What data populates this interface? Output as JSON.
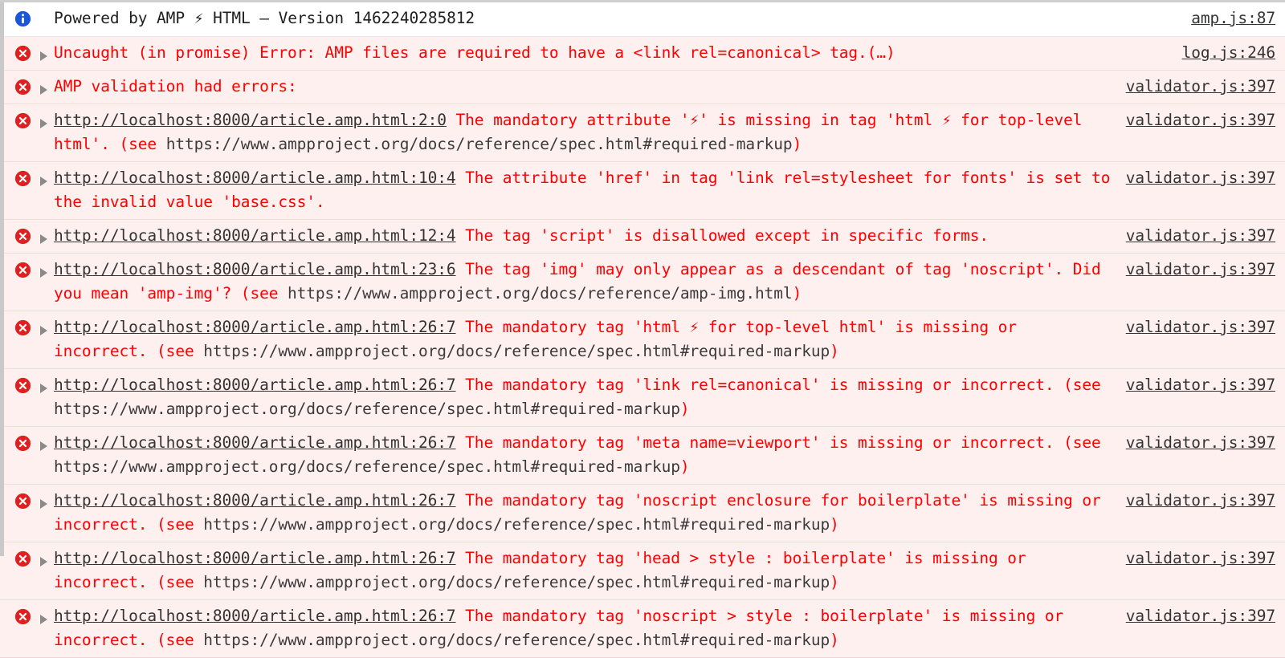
{
  "console": {
    "title": "Browser DevTools Console",
    "colors": {
      "error_text": "#ff0000",
      "error_row_bg": "#fff0f0",
      "error_row_border": "#ffd6d6",
      "info_row_bg": "#ffffff",
      "link_text": "#333333",
      "url_text": "#3b3b3b",
      "error_icon": "#e02020",
      "info_icon": "#1a56d6",
      "disclosure_triangle": "#8a8a8a",
      "gutter": "#c9c9c9"
    },
    "messages": [
      {
        "severity": "info",
        "icon": "info-circle-icon",
        "has_disclosure": false,
        "source": "amp.js:87",
        "parts": [
          {
            "style": "plain",
            "text": "Powered by AMP "
          },
          {
            "style": "bolt",
            "text": "⚡"
          },
          {
            "style": "plain",
            "text": " HTML — Version 1462240285812"
          }
        ]
      },
      {
        "severity": "error",
        "icon": "error-circle-icon",
        "has_disclosure": true,
        "source": "log.js:246",
        "parts": [
          {
            "style": "red",
            "text": "Uncaught (in promise) Error: AMP files are required to have a <link rel=canonical> tag.(…)"
          }
        ]
      },
      {
        "severity": "error",
        "icon": "error-circle-icon",
        "has_disclosure": true,
        "source": "validator.js:397",
        "parts": [
          {
            "style": "red",
            "text": "AMP validation had errors:"
          }
        ]
      },
      {
        "severity": "error",
        "icon": "error-circle-icon",
        "has_disclosure": true,
        "source": "validator.js:397",
        "parts": [
          {
            "style": "link",
            "text": "http://localhost:8000/article.amp.html:2:0"
          },
          {
            "style": "red",
            "text": " The mandatory attribute '⚡' is missing in tag 'html ⚡ for top-level html'. (see "
          },
          {
            "style": "url",
            "text": "https://www.ampproject.org/docs/reference/spec.html#required-markup"
          },
          {
            "style": "red",
            "text": ")"
          }
        ]
      },
      {
        "severity": "error",
        "icon": "error-circle-icon",
        "has_disclosure": true,
        "source": "validator.js:397",
        "parts": [
          {
            "style": "link",
            "text": "http://localhost:8000/article.amp.html:10:4"
          },
          {
            "style": "red",
            "text": " The attribute 'href' in tag 'link rel=stylesheet for fonts' is set to the invalid value 'base.css'."
          }
        ]
      },
      {
        "severity": "error",
        "icon": "error-circle-icon",
        "has_disclosure": true,
        "source": "validator.js:397",
        "parts": [
          {
            "style": "link",
            "text": "http://localhost:8000/article.amp.html:12:4"
          },
          {
            "style": "red",
            "text": " The tag 'script' is disallowed except in specific forms."
          }
        ]
      },
      {
        "severity": "error",
        "icon": "error-circle-icon",
        "has_disclosure": true,
        "source": "validator.js:397",
        "parts": [
          {
            "style": "link",
            "text": "http://localhost:8000/article.amp.html:23:6"
          },
          {
            "style": "red",
            "text": " The tag 'img' may only appear as a descendant of tag 'noscript'. Did you mean 'amp-img'? (see "
          },
          {
            "style": "url",
            "text": "https://www.ampproject.org/docs/reference/amp-img.html"
          },
          {
            "style": "red",
            "text": ")"
          }
        ]
      },
      {
        "severity": "error",
        "icon": "error-circle-icon",
        "has_disclosure": true,
        "source": "validator.js:397",
        "parts": [
          {
            "style": "link",
            "text": "http://localhost:8000/article.amp.html:26:7"
          },
          {
            "style": "red",
            "text": " The mandatory tag 'html ⚡ for top-level html' is missing or incorrect. (see "
          },
          {
            "style": "url",
            "text": "https://www.ampproject.org/docs/reference/spec.html#required-markup"
          },
          {
            "style": "red",
            "text": ")"
          }
        ]
      },
      {
        "severity": "error",
        "icon": "error-circle-icon",
        "has_disclosure": true,
        "source": "validator.js:397",
        "parts": [
          {
            "style": "link",
            "text": "http://localhost:8000/article.amp.html:26:7"
          },
          {
            "style": "red",
            "text": " The mandatory tag 'link rel=canonical' is missing or incorrect. (see "
          },
          {
            "style": "url",
            "text": "https://www.ampproject.org/docs/reference/spec.html#required-markup"
          },
          {
            "style": "red",
            "text": ")"
          }
        ]
      },
      {
        "severity": "error",
        "icon": "error-circle-icon",
        "has_disclosure": true,
        "source": "validator.js:397",
        "parts": [
          {
            "style": "link",
            "text": "http://localhost:8000/article.amp.html:26:7"
          },
          {
            "style": "red",
            "text": " The mandatory tag 'meta name=viewport' is missing or incorrect. (see "
          },
          {
            "style": "url",
            "text": "https://www.ampproject.org/docs/reference/spec.html#required-markup"
          },
          {
            "style": "red",
            "text": ")"
          }
        ]
      },
      {
        "severity": "error",
        "icon": "error-circle-icon",
        "has_disclosure": true,
        "source": "validator.js:397",
        "parts": [
          {
            "style": "link",
            "text": "http://localhost:8000/article.amp.html:26:7"
          },
          {
            "style": "red",
            "text": " The mandatory tag 'noscript enclosure for boilerplate' is missing or incorrect. (see "
          },
          {
            "style": "url",
            "text": "https://www.ampproject.org/docs/reference/spec.html#required-markup"
          },
          {
            "style": "red",
            "text": ")"
          }
        ]
      },
      {
        "severity": "error",
        "icon": "error-circle-icon",
        "has_disclosure": true,
        "source": "validator.js:397",
        "parts": [
          {
            "style": "link",
            "text": "http://localhost:8000/article.amp.html:26:7"
          },
          {
            "style": "red",
            "text": " The mandatory tag 'head > style : boilerplate' is missing or incorrect. (see "
          },
          {
            "style": "url",
            "text": "https://www.ampproject.org/docs/reference/spec.html#required-markup"
          },
          {
            "style": "red",
            "text": ")"
          }
        ]
      },
      {
        "severity": "error",
        "icon": "error-circle-icon",
        "has_disclosure": true,
        "source": "validator.js:397",
        "parts": [
          {
            "style": "link",
            "text": "http://localhost:8000/article.amp.html:26:7"
          },
          {
            "style": "red",
            "text": " The mandatory tag 'noscript > style : boilerplate' is missing or incorrect. (see "
          },
          {
            "style": "url",
            "text": "https://www.ampproject.org/docs/reference/spec.html#required-markup"
          },
          {
            "style": "red",
            "text": ")"
          }
        ]
      }
    ]
  }
}
